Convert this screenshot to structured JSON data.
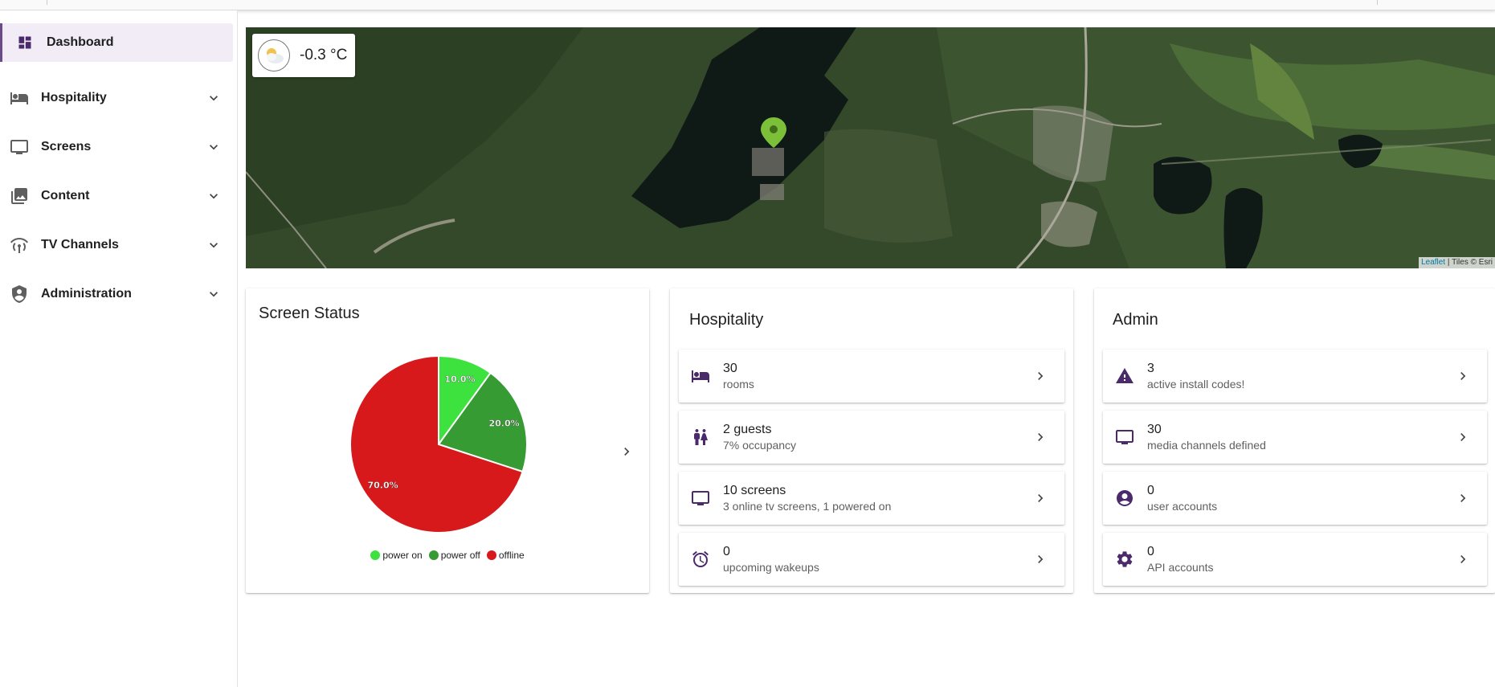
{
  "sidebar": {
    "items": [
      {
        "label": "Dashboard",
        "icon": "dashboard-icon",
        "active": true
      },
      {
        "label": "Hospitality",
        "icon": "bed-icon"
      },
      {
        "label": "Screens",
        "icon": "monitor-icon"
      },
      {
        "label": "Content",
        "icon": "photo-library-icon"
      },
      {
        "label": "TV Channels",
        "icon": "broadcast-icon"
      },
      {
        "label": "Administration",
        "icon": "admin-shield-icon"
      }
    ]
  },
  "map": {
    "weather_temp": "-0.3 °C",
    "weather_icon": "partly-cloudy-icon",
    "attribution_leaflet": "Leaflet",
    "attribution_tiles": "| Tiles © Esri"
  },
  "screen_status": {
    "title": "Screen Status",
    "chart_data": {
      "type": "pie",
      "title": "Screen Status",
      "categories": [
        "power on",
        "power off",
        "offline"
      ],
      "values": [
        10.0,
        20.0,
        70.0
      ],
      "labels": [
        "10.0%",
        "20.0%",
        "70.0%"
      ],
      "colors": [
        "#3de23f",
        "#379b34",
        "#d7191c"
      ],
      "legend_position": "bottom"
    }
  },
  "hospitality": {
    "title": "Hospitality",
    "items": [
      {
        "primary": "30",
        "secondary": "rooms",
        "icon": "bed-icon"
      },
      {
        "primary": "2 guests",
        "secondary": "7% occupancy",
        "icon": "people-icon"
      },
      {
        "primary": "10 screens",
        "secondary": "3 online tv screens, 1 powered on",
        "icon": "monitor-icon"
      },
      {
        "primary": "0",
        "secondary": "upcoming wakeups",
        "icon": "alarm-icon"
      }
    ]
  },
  "admin": {
    "title": "Admin",
    "items": [
      {
        "primary": "3",
        "secondary": "active install codes!",
        "icon": "warning-icon"
      },
      {
        "primary": "30",
        "secondary": "media channels defined",
        "icon": "monitor-icon"
      },
      {
        "primary": "0",
        "secondary": "user accounts",
        "icon": "account-circle-icon"
      },
      {
        "primary": "0",
        "secondary": "API accounts",
        "icon": "cog-icon"
      }
    ]
  },
  "colors": {
    "accent": "#4a2a6b",
    "active_bg": "#f1ecf6"
  }
}
